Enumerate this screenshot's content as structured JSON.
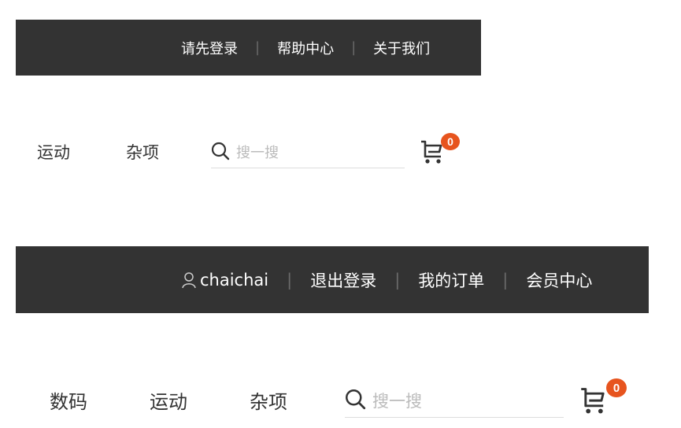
{
  "header_guest": {
    "links": [
      "请先登录",
      "帮助中心",
      "关于我们"
    ],
    "separator": "|"
  },
  "nav_guest": {
    "categories": [
      "运动",
      "杂项"
    ],
    "search_placeholder": "搜一搜",
    "cart_count": "0"
  },
  "header_user": {
    "username": "chaichai",
    "links": [
      "退出登录",
      "我的订单",
      "会员中心"
    ],
    "separator": "|"
  },
  "nav_user": {
    "categories": [
      "数码",
      "运动",
      "杂项"
    ],
    "search_placeholder": "搜一搜",
    "cart_count": "0"
  },
  "colors": {
    "topbar_bg": "#333333",
    "badge": "#e7541e",
    "placeholder": "#bbbbbb"
  },
  "icons": [
    "search-icon",
    "cart-icon",
    "user-icon"
  ]
}
